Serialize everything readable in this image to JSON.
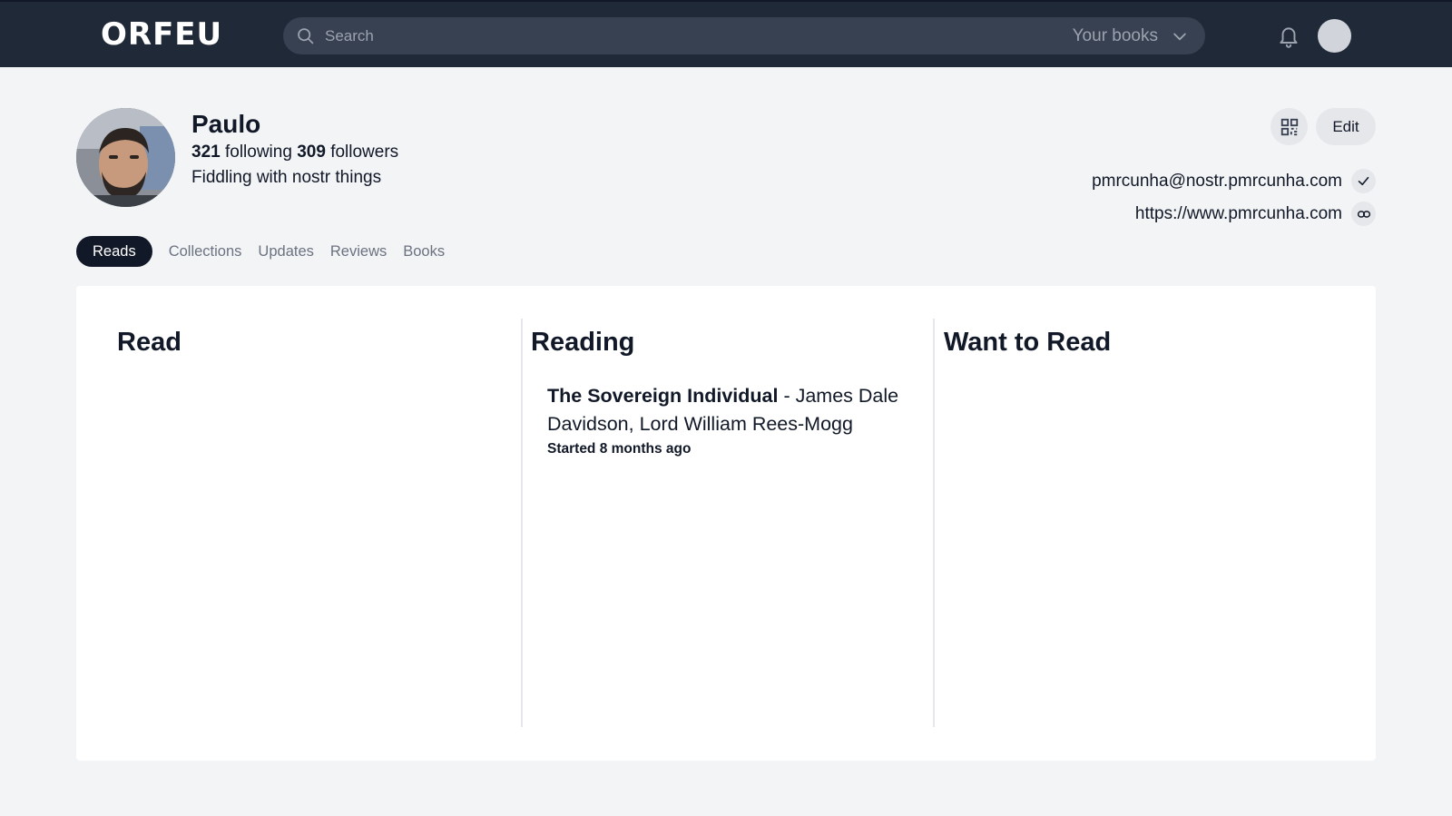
{
  "header": {
    "logo": "ORFEU",
    "search_placeholder": "Search",
    "scope_label": "Your books"
  },
  "profile": {
    "name": "Paulo",
    "following_count": "321",
    "following_label": "following",
    "followers_count": "309",
    "followers_label": "followers",
    "bio": "Fiddling with nostr things",
    "edit_label": "Edit",
    "nip05": "pmrcunha@nostr.pmrcunha.com",
    "website": "https://www.pmrcunha.com"
  },
  "tabs": [
    {
      "label": "Reads",
      "active": true
    },
    {
      "label": "Collections",
      "active": false
    },
    {
      "label": "Updates",
      "active": false
    },
    {
      "label": "Reviews",
      "active": false
    },
    {
      "label": "Books",
      "active": false
    }
  ],
  "columns": {
    "read": {
      "title": "Read"
    },
    "reading": {
      "title": "Reading",
      "books": [
        {
          "title": "The Sovereign Individual",
          "authors_line1": "- James Dale",
          "authors_line2": "Davidson, Lord William Rees-Mogg",
          "status": "Started 8 months ago"
        }
      ]
    },
    "want": {
      "title": "Want to Read"
    }
  },
  "colors": {
    "header_bg": "#1f2937",
    "search_bg": "#374151",
    "page_bg": "#f3f4f6",
    "active_tab_bg": "#111827"
  }
}
